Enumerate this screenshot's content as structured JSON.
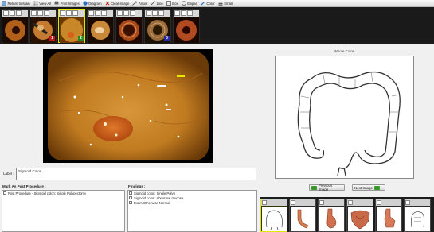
{
  "toolbar": {
    "items": [
      {
        "label": "Return to Main",
        "icon": "return-icon"
      },
      {
        "label": "View All",
        "icon": "view-all-icon"
      },
      {
        "label": "Print Images",
        "icon": "print-icon"
      },
      {
        "label": "Diagram",
        "icon": "diagram-icon"
      },
      {
        "label": "Clear Image",
        "icon": "clear-icon"
      },
      {
        "label": "Arrow",
        "icon": "arrow-icon"
      },
      {
        "label": "Line",
        "icon": "line-icon"
      },
      {
        "label": "Box",
        "icon": "box-icon"
      },
      {
        "label": "Ellipse",
        "icon": "ellipse-icon"
      },
      {
        "label": "Color",
        "icon": "color-icon"
      },
      {
        "label": "Small",
        "icon": "small-icon"
      }
    ]
  },
  "thumbnails": [
    {
      "checked": false,
      "badge": "",
      "selected": false
    },
    {
      "checked": false,
      "badge": "1",
      "badge_color": "#c01818",
      "selected": false
    },
    {
      "checked": true,
      "badge": "2",
      "badge_color": "#2a8a2a",
      "selected": true
    },
    {
      "checked": false,
      "badge": "",
      "selected": false
    },
    {
      "checked": false,
      "badge": "",
      "selected": false
    },
    {
      "checked": true,
      "badge": "3",
      "badge_color": "#2a2aa0",
      "selected": false
    },
    {
      "checked": false,
      "badge": "",
      "selected": false
    }
  ],
  "whole_colon_title": "Whole Colon",
  "label_caption": "Label :",
  "label_value": "Sigmoid Colon",
  "previous_button": "Previous Image",
  "next_button": "Next Image",
  "mark_as_post_title": "Mark As Post Procedure :",
  "post_procedure_items": [
    {
      "text": "Post Procedure - Sigmoid colon: Single Polypectomy",
      "checked": false
    }
  ],
  "findings_title": "Findings :",
  "findings_items": [
    {
      "text": "Sigmoid colon: Single Polyp",
      "checked": false
    },
    {
      "text": "Sigmoid colon: Abnormal mucosa",
      "checked": false
    },
    {
      "text": "Exam Otherwise Normal",
      "checked": false
    }
  ],
  "diagram_thumbs": [
    {
      "selected": true,
      "checked": true
    },
    {
      "selected": false,
      "checked": false
    },
    {
      "selected": false,
      "checked": false
    },
    {
      "selected": false,
      "checked": false
    },
    {
      "selected": false,
      "checked": false
    },
    {
      "selected": false,
      "checked": false
    }
  ],
  "colors": {
    "accent": "#3a9a2a",
    "selected_border": "#e6e600",
    "mucosa": "#c8882a"
  }
}
